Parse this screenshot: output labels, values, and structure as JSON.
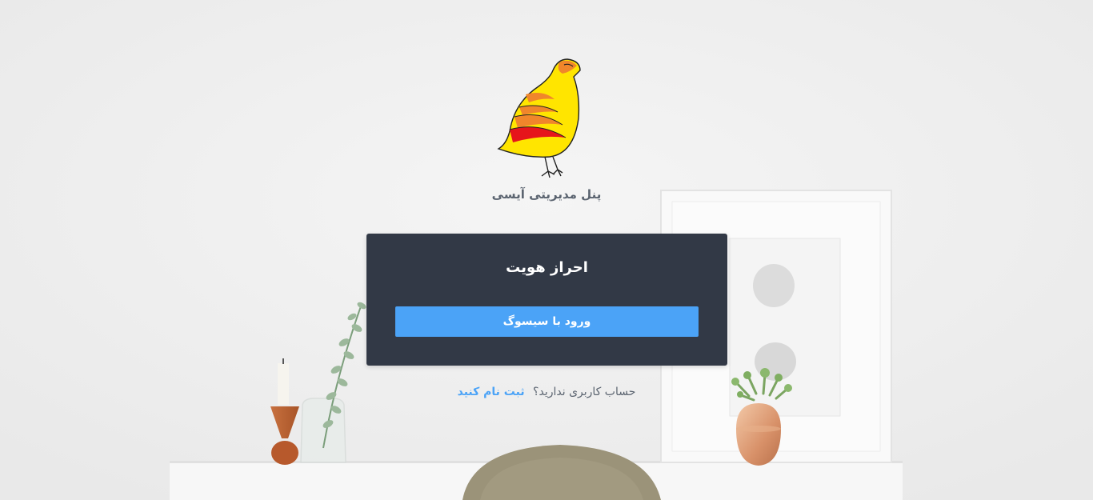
{
  "app": {
    "title": "پنل مدیریتی آیسی"
  },
  "auth_card": {
    "title": "احراز هویت",
    "login_button_label": "ورود با سیسوگ"
  },
  "register": {
    "prompt": "حساب کاربری ندارید؟",
    "link_label": "ثبت نام کنید"
  },
  "colors": {
    "card_background": "#323946",
    "button_primary": "#4ba3f7",
    "link": "#4ba3f7",
    "muted_text": "#5b6470"
  }
}
